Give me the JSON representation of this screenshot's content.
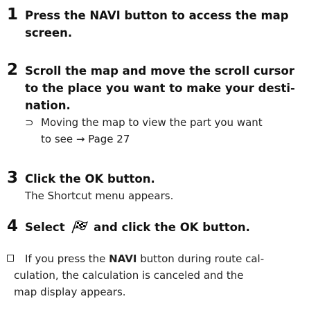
{
  "steps": [
    {
      "number": "1",
      "title_lines": [
        "Press the NAVI button to access the map",
        "screen."
      ]
    },
    {
      "number": "2",
      "title_lines": [
        "Scroll the map and move the scroll cursor",
        "to the place you want to make your desti-",
        "nation."
      ],
      "note": {
        "bullet": "⊃",
        "lines": [
          "Moving the map to view the part you want",
          "to see → Page 27"
        ]
      }
    },
    {
      "number": "3",
      "title": "Click the OK button.",
      "body": "The Shortcut menu appears."
    },
    {
      "number": "4",
      "title_before_icon": "Select",
      "icon": "destination-flag-icon",
      "title_after_icon": "and click the OK button."
    }
  ],
  "footnote": {
    "bullet_icon": "checkbox-square-icon",
    "line1_before": "If you press the ",
    "line1_bold": "NAVI",
    "line1_after": " button during route cal-",
    "line2": "culation, the calculation is canceled and the",
    "line3": "map display appears."
  }
}
